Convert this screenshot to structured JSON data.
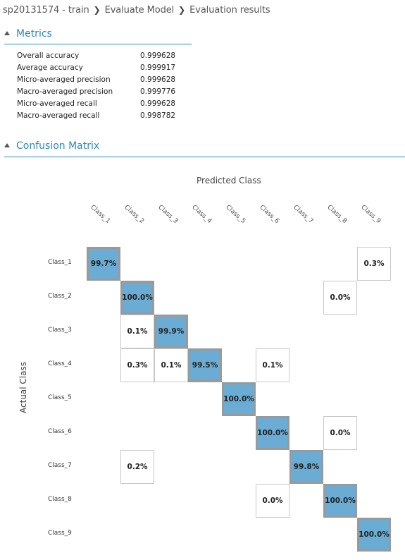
{
  "breadcrumb": {
    "items": [
      "sp20131574 - train",
      "Evaluate Model",
      "Evaluation results"
    ]
  },
  "metrics_section": {
    "title": "Metrics",
    "expanded": true
  },
  "metrics": [
    {
      "name": "Overall accuracy",
      "value": "0.999628"
    },
    {
      "name": "Average accuracy",
      "value": "0.999917"
    },
    {
      "name": "Micro-averaged precision",
      "value": "0.999628"
    },
    {
      "name": "Macro-averaged precision",
      "value": "0.999776"
    },
    {
      "name": "Micro-averaged recall",
      "value": "0.999628"
    },
    {
      "name": "Macro-averaged recall",
      "value": "0.998782"
    }
  ],
  "confusion_section": {
    "title": "Confusion Matrix",
    "expanded": true
  },
  "confusion": {
    "x_title": "Predicted Class",
    "y_title": "Actual Class",
    "classes": [
      "Class_1",
      "Class_2",
      "Class_3",
      "Class_4",
      "Class_5",
      "Class_6",
      "Class_7",
      "Class_8",
      "Class_9"
    ],
    "cells": [
      {
        "actual": "Class_1",
        "predicted": "Class_1",
        "text": "99.7%",
        "diagonal": true
      },
      {
        "actual": "Class_1",
        "predicted": "Class_9",
        "text": "0.3%",
        "diagonal": false
      },
      {
        "actual": "Class_2",
        "predicted": "Class_2",
        "text": "100.0%",
        "diagonal": true
      },
      {
        "actual": "Class_2",
        "predicted": "Class_8",
        "text": "0.0%",
        "diagonal": false
      },
      {
        "actual": "Class_3",
        "predicted": "Class_2",
        "text": "0.1%",
        "diagonal": false
      },
      {
        "actual": "Class_3",
        "predicted": "Class_3",
        "text": "99.9%",
        "diagonal": true
      },
      {
        "actual": "Class_4",
        "predicted": "Class_2",
        "text": "0.3%",
        "diagonal": false
      },
      {
        "actual": "Class_4",
        "predicted": "Class_3",
        "text": "0.1%",
        "diagonal": false
      },
      {
        "actual": "Class_4",
        "predicted": "Class_4",
        "text": "99.5%",
        "diagonal": true
      },
      {
        "actual": "Class_4",
        "predicted": "Class_6",
        "text": "0.1%",
        "diagonal": false
      },
      {
        "actual": "Class_5",
        "predicted": "Class_5",
        "text": "100.0%",
        "diagonal": true
      },
      {
        "actual": "Class_6",
        "predicted": "Class_6",
        "text": "100.0%",
        "diagonal": true
      },
      {
        "actual": "Class_6",
        "predicted": "Class_8",
        "text": "0.0%",
        "diagonal": false
      },
      {
        "actual": "Class_7",
        "predicted": "Class_2",
        "text": "0.2%",
        "diagonal": false
      },
      {
        "actual": "Class_7",
        "predicted": "Class_7",
        "text": "99.8%",
        "diagonal": true
      },
      {
        "actual": "Class_8",
        "predicted": "Class_6",
        "text": "0.0%",
        "diagonal": false
      },
      {
        "actual": "Class_8",
        "predicted": "Class_8",
        "text": "100.0%",
        "diagonal": true
      },
      {
        "actual": "Class_9",
        "predicted": "Class_9",
        "text": "100.0%",
        "diagonal": true
      }
    ]
  },
  "colors": {
    "accent": "#2b88c8",
    "diagonal_fill": "#6aacd3",
    "diagonal_border": "#9a9a9a",
    "offdiag_border": "#c8c8c8"
  },
  "icons": {
    "breadcrumb_separator": "chevron-right-icon",
    "section_toggle": "triangle-up-icon"
  }
}
